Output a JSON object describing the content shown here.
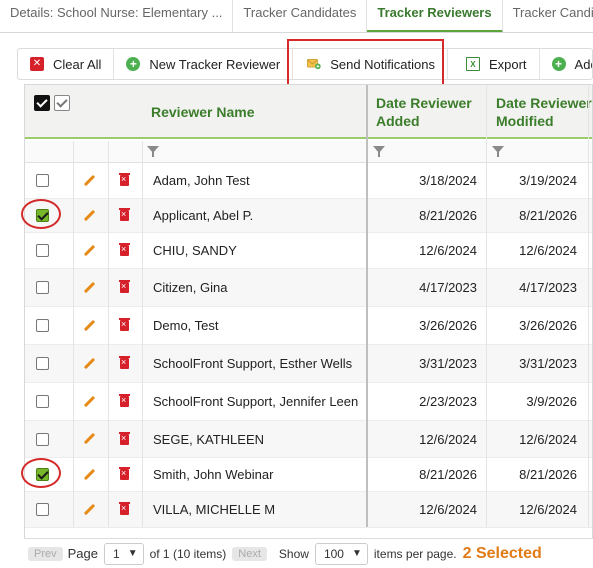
{
  "tabs": [
    {
      "label": "Details: School Nurse: Elementary ..."
    },
    {
      "label": "Tracker Candidates"
    },
    {
      "label": "Tracker Reviewers",
      "active": true
    },
    {
      "label": "Tracker Candid"
    }
  ],
  "toolbar": {
    "clear_all": "Clear All",
    "new_reviewer": "New Tracker Reviewer",
    "send_notifications": "Send Notifications",
    "export": "Export",
    "add": "Add"
  },
  "columns": {
    "reviewer_name": "Reviewer Name",
    "date_added": "Date Reviewer Added",
    "date_modified": "Date Reviewer Modified"
  },
  "rows": [
    {
      "checked": false,
      "name": "Adam, John Test",
      "added": "3/18/2024",
      "modified": "3/19/2024"
    },
    {
      "checked": true,
      "name": "Applicant, Abel P.",
      "added": "8/21/2026",
      "modified": "8/21/2026"
    },
    {
      "checked": false,
      "name": "CHIU, SANDY",
      "added": "12/6/2024",
      "modified": "12/6/2024"
    },
    {
      "checked": false,
      "name": "Citizen, Gina",
      "added": "4/17/2023",
      "modified": "4/17/2023"
    },
    {
      "checked": false,
      "name": "Demo, Test",
      "added": "3/26/2026",
      "modified": "3/26/2026"
    },
    {
      "checked": false,
      "name": "SchoolFront Support, Esther Wells",
      "added": "3/31/2023",
      "modified": "3/31/2023"
    },
    {
      "checked": false,
      "name": "SchoolFront Support, Jennifer Leen",
      "added": "2/23/2023",
      "modified": "3/9/2026"
    },
    {
      "checked": false,
      "name": "SEGE, KATHLEEN",
      "added": "12/6/2024",
      "modified": "12/6/2024"
    },
    {
      "checked": true,
      "name": "Smith, John Webinar",
      "added": "8/21/2026",
      "modified": "8/21/2026"
    },
    {
      "checked": false,
      "name": "VILLA, MICHELLE M",
      "added": "12/6/2024",
      "modified": "12/6/2024"
    }
  ],
  "pager": {
    "prev": "Prev",
    "page_label": "Page",
    "page_value": "1",
    "of_text": "of 1 (10 items)",
    "next": "Next",
    "show_label": "Show",
    "page_size": "100",
    "per_page_text": "items per page.",
    "selected_text": "2 Selected"
  },
  "colors": {
    "accent_green": "#3b7d2a",
    "highlight_red": "#d42a2a",
    "selected_orange": "#e07b16"
  }
}
